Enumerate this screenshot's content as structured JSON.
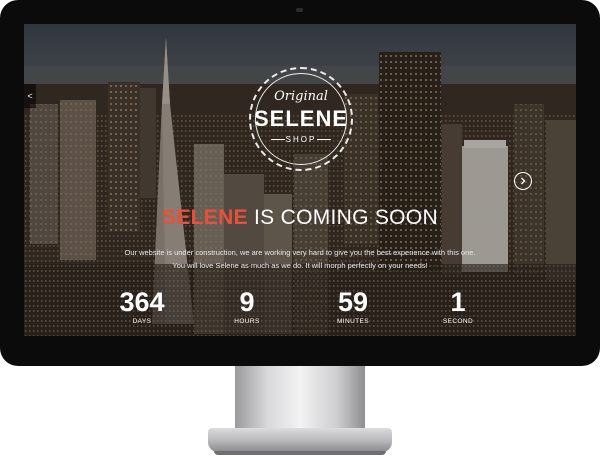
{
  "logo": {
    "script_text": "Original",
    "brand": "SELENE",
    "subtitle": "SHOP"
  },
  "headline": {
    "accent": "SELENE",
    "rest": "IS COMING SOON"
  },
  "description": {
    "line1": "Our website is under construction, we are working very hard to give you the best experience with this one.",
    "line2": "You will love Selene as much as we do. It will morph perfectly on your needs!"
  },
  "countdown": [
    {
      "value": "364",
      "unit": "DAYS"
    },
    {
      "value": "9",
      "unit": "HOURS"
    },
    {
      "value": "59",
      "unit": "MINUTES"
    },
    {
      "value": "1",
      "unit": "SECOND"
    }
  ],
  "icons": {
    "side_toggle": "share-icon",
    "next": "chevron-right-icon"
  },
  "colors": {
    "accent": "#e8503a",
    "bezel": "#0b0b0c",
    "text": "#ffffff"
  }
}
